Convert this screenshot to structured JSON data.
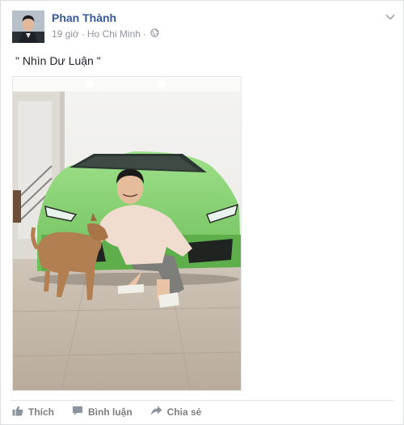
{
  "post": {
    "author": "Phan Thành",
    "time": "19 giờ",
    "separator": "·",
    "location": "Ho Chi Minh",
    "middot": "·",
    "text": "\" Nhìn Dư Luận \""
  },
  "actions": {
    "like": "Thích",
    "comment": "Bình luận",
    "share": "Chia sẻ"
  },
  "icons": {
    "globe": "globe-icon",
    "chevron": "chevron-down-icon",
    "like": "thumbs-up-icon",
    "comment": "comment-icon",
    "share": "share-arrow-icon"
  },
  "colors": {
    "name_link": "#365899",
    "meta": "#90949c",
    "action": "#7f7f7f",
    "car_green": "#7fcf6a"
  }
}
